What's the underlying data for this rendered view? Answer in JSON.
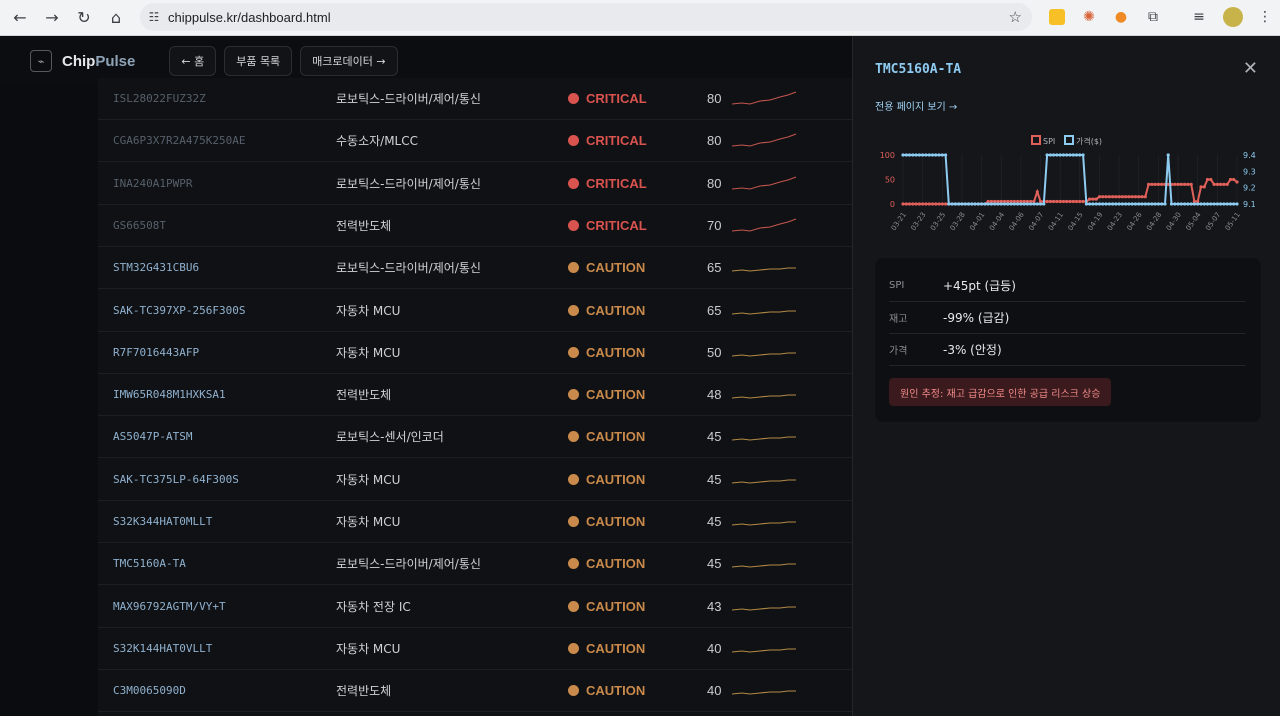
{
  "browser": {
    "url": "chippulse.kr/dashboard.html"
  },
  "header": {
    "logo_part1": "Chip",
    "logo_part2": "Pulse",
    "buttons": [
      "← 홈",
      "부품 목록",
      "매크로데이터 →"
    ]
  },
  "colors": {
    "critical": "#d9534f",
    "caution": "#c98a4b",
    "spark_critical": "#c4554f",
    "spark_caution": "#b48a45"
  },
  "rows": [
    {
      "part": "ISL28022FUZ32Z",
      "category": "로보틱스-드라이버/제어/통신",
      "status": "CRITICAL",
      "score": "80",
      "level": "critical",
      "dim": true
    },
    {
      "part": "CGA6P3X7R2A475K250AE",
      "category": "수동소자/MLCC",
      "status": "CRITICAL",
      "score": "80",
      "level": "critical",
      "dim": true
    },
    {
      "part": "INA240A1PWPR",
      "category": "로보틱스-드라이버/제어/통신",
      "status": "CRITICAL",
      "score": "80",
      "level": "critical",
      "dim": true
    },
    {
      "part": "GS66508T",
      "category": "전력반도체",
      "status": "CRITICAL",
      "score": "70",
      "level": "critical",
      "dim": true
    },
    {
      "part": "STM32G431CBU6",
      "category": "로보틱스-드라이버/제어/통신",
      "status": "CAUTION",
      "score": "65",
      "level": "caution",
      "dim": false
    },
    {
      "part": "SAK-TC397XP-256F300S",
      "category": "자동차 MCU",
      "status": "CAUTION",
      "score": "65",
      "level": "caution",
      "dim": false
    },
    {
      "part": "R7F7016443AFP",
      "category": "자동차 MCU",
      "status": "CAUTION",
      "score": "50",
      "level": "caution",
      "dim": false
    },
    {
      "part": "IMW65R048M1HXKSA1",
      "category": "전력반도체",
      "status": "CAUTION",
      "score": "48",
      "level": "caution",
      "dim": false
    },
    {
      "part": "AS5047P-ATSM",
      "category": "로보틱스-센서/인코더",
      "status": "CAUTION",
      "score": "45",
      "level": "caution",
      "dim": false
    },
    {
      "part": "SAK-TC375LP-64F300S",
      "category": "자동차 MCU",
      "status": "CAUTION",
      "score": "45",
      "level": "caution",
      "dim": false
    },
    {
      "part": "S32K344HAT0MLLT",
      "category": "자동차 MCU",
      "status": "CAUTION",
      "score": "45",
      "level": "caution",
      "dim": false
    },
    {
      "part": "TMC5160A-TA",
      "category": "로보틱스-드라이버/제어/통신",
      "status": "CAUTION",
      "score": "45",
      "level": "caution",
      "dim": false
    },
    {
      "part": "MAX96792AGTM/VY+T",
      "category": "자동차 전장 IC",
      "status": "CAUTION",
      "score": "43",
      "level": "caution",
      "dim": false
    },
    {
      "part": "S32K144HAT0VLLT",
      "category": "자동차 MCU",
      "status": "CAUTION",
      "score": "40",
      "level": "caution",
      "dim": false
    },
    {
      "part": "C3M0065090D",
      "category": "전력반도체",
      "status": "CAUTION",
      "score": "40",
      "level": "caution",
      "dim": false
    }
  ],
  "panel": {
    "title": "TMC5160A-TA",
    "link": "전용 페이지 보기 →",
    "stats": [
      {
        "label": "SPI",
        "value": "+45pt (급등)"
      },
      {
        "label": "재고",
        "value": "-99% (급감)"
      },
      {
        "label": "가격",
        "value": "-3% (안정)"
      }
    ],
    "cause": "원인 추정: 재고 급감으로 인한 공급 리스크 상승"
  },
  "chart_data": {
    "type": "line",
    "legend": [
      "SPI",
      "가격($)"
    ],
    "series_colors": [
      "#e0605a",
      "#8ecbf0"
    ],
    "x_ticks": [
      "03-21",
      "03-23",
      "03-25",
      "03-28",
      "04-01",
      "04-04",
      "04-06",
      "04-07",
      "04-11",
      "04-15",
      "04-19",
      "04-23",
      "04-26",
      "04-28",
      "04-30",
      "05-04",
      "05-07",
      "05-11"
    ],
    "y_left_ticks": [
      "100",
      "50",
      "0"
    ],
    "y_right_ticks": [
      "9.4",
      "9.3",
      "9.2",
      "9.1"
    ],
    "ylim_left": [
      0,
      100
    ],
    "ylim_right": [
      9.1,
      9.4
    ],
    "series": [
      {
        "name": "SPI",
        "axis": "left",
        "values": [
          0,
          0,
          0,
          0,
          0,
          0,
          0,
          0,
          0,
          0,
          0,
          0,
          0,
          0,
          0,
          0,
          0,
          0,
          0,
          0,
          0,
          0,
          0,
          0,
          0,
          0,
          5,
          5,
          5,
          5,
          5,
          5,
          5,
          5,
          5,
          5,
          5,
          5,
          5,
          5,
          5,
          25,
          5,
          5,
          5,
          5,
          5,
          5,
          5,
          5,
          5,
          5,
          5,
          5,
          5,
          5,
          5,
          10,
          10,
          10,
          15,
          15,
          15,
          15,
          15,
          15,
          15,
          15,
          15,
          15,
          15,
          15,
          15,
          15,
          15,
          40,
          40,
          40,
          40,
          40,
          40,
          40,
          40,
          40,
          40,
          40,
          40,
          40,
          40,
          5,
          5,
          35,
          35,
          50,
          50,
          40,
          40,
          40,
          40,
          40,
          50,
          50,
          45
        ]
      },
      {
        "name": "가격($)",
        "axis": "right",
        "values": [
          9.4,
          9.4,
          9.4,
          9.4,
          9.4,
          9.4,
          9.4,
          9.4,
          9.4,
          9.4,
          9.4,
          9.4,
          9.4,
          9.4,
          9.1,
          9.1,
          9.1,
          9.1,
          9.1,
          9.1,
          9.1,
          9.1,
          9.1,
          9.1,
          9.1,
          9.1,
          9.1,
          9.1,
          9.1,
          9.1,
          9.1,
          9.1,
          9.1,
          9.1,
          9.1,
          9.1,
          9.1,
          9.1,
          9.1,
          9.1,
          9.1,
          9.1,
          9.1,
          9.1,
          9.4,
          9.4,
          9.4,
          9.4,
          9.4,
          9.4,
          9.4,
          9.4,
          9.4,
          9.4,
          9.4,
          9.4,
          9.1,
          9.1,
          9.1,
          9.1,
          9.1,
          9.1,
          9.1,
          9.1,
          9.1,
          9.1,
          9.1,
          9.1,
          9.1,
          9.1,
          9.1,
          9.1,
          9.1,
          9.1,
          9.1,
          9.1,
          9.1,
          9.1,
          9.1,
          9.1,
          9.1,
          9.4,
          9.1,
          9.1,
          9.1,
          9.1,
          9.1,
          9.1,
          9.1,
          9.1,
          9.1,
          9.1,
          9.1,
          9.1,
          9.1,
          9.1,
          9.1,
          9.1,
          9.1,
          9.1,
          9.1,
          9.1,
          9.1
        ]
      }
    ]
  }
}
